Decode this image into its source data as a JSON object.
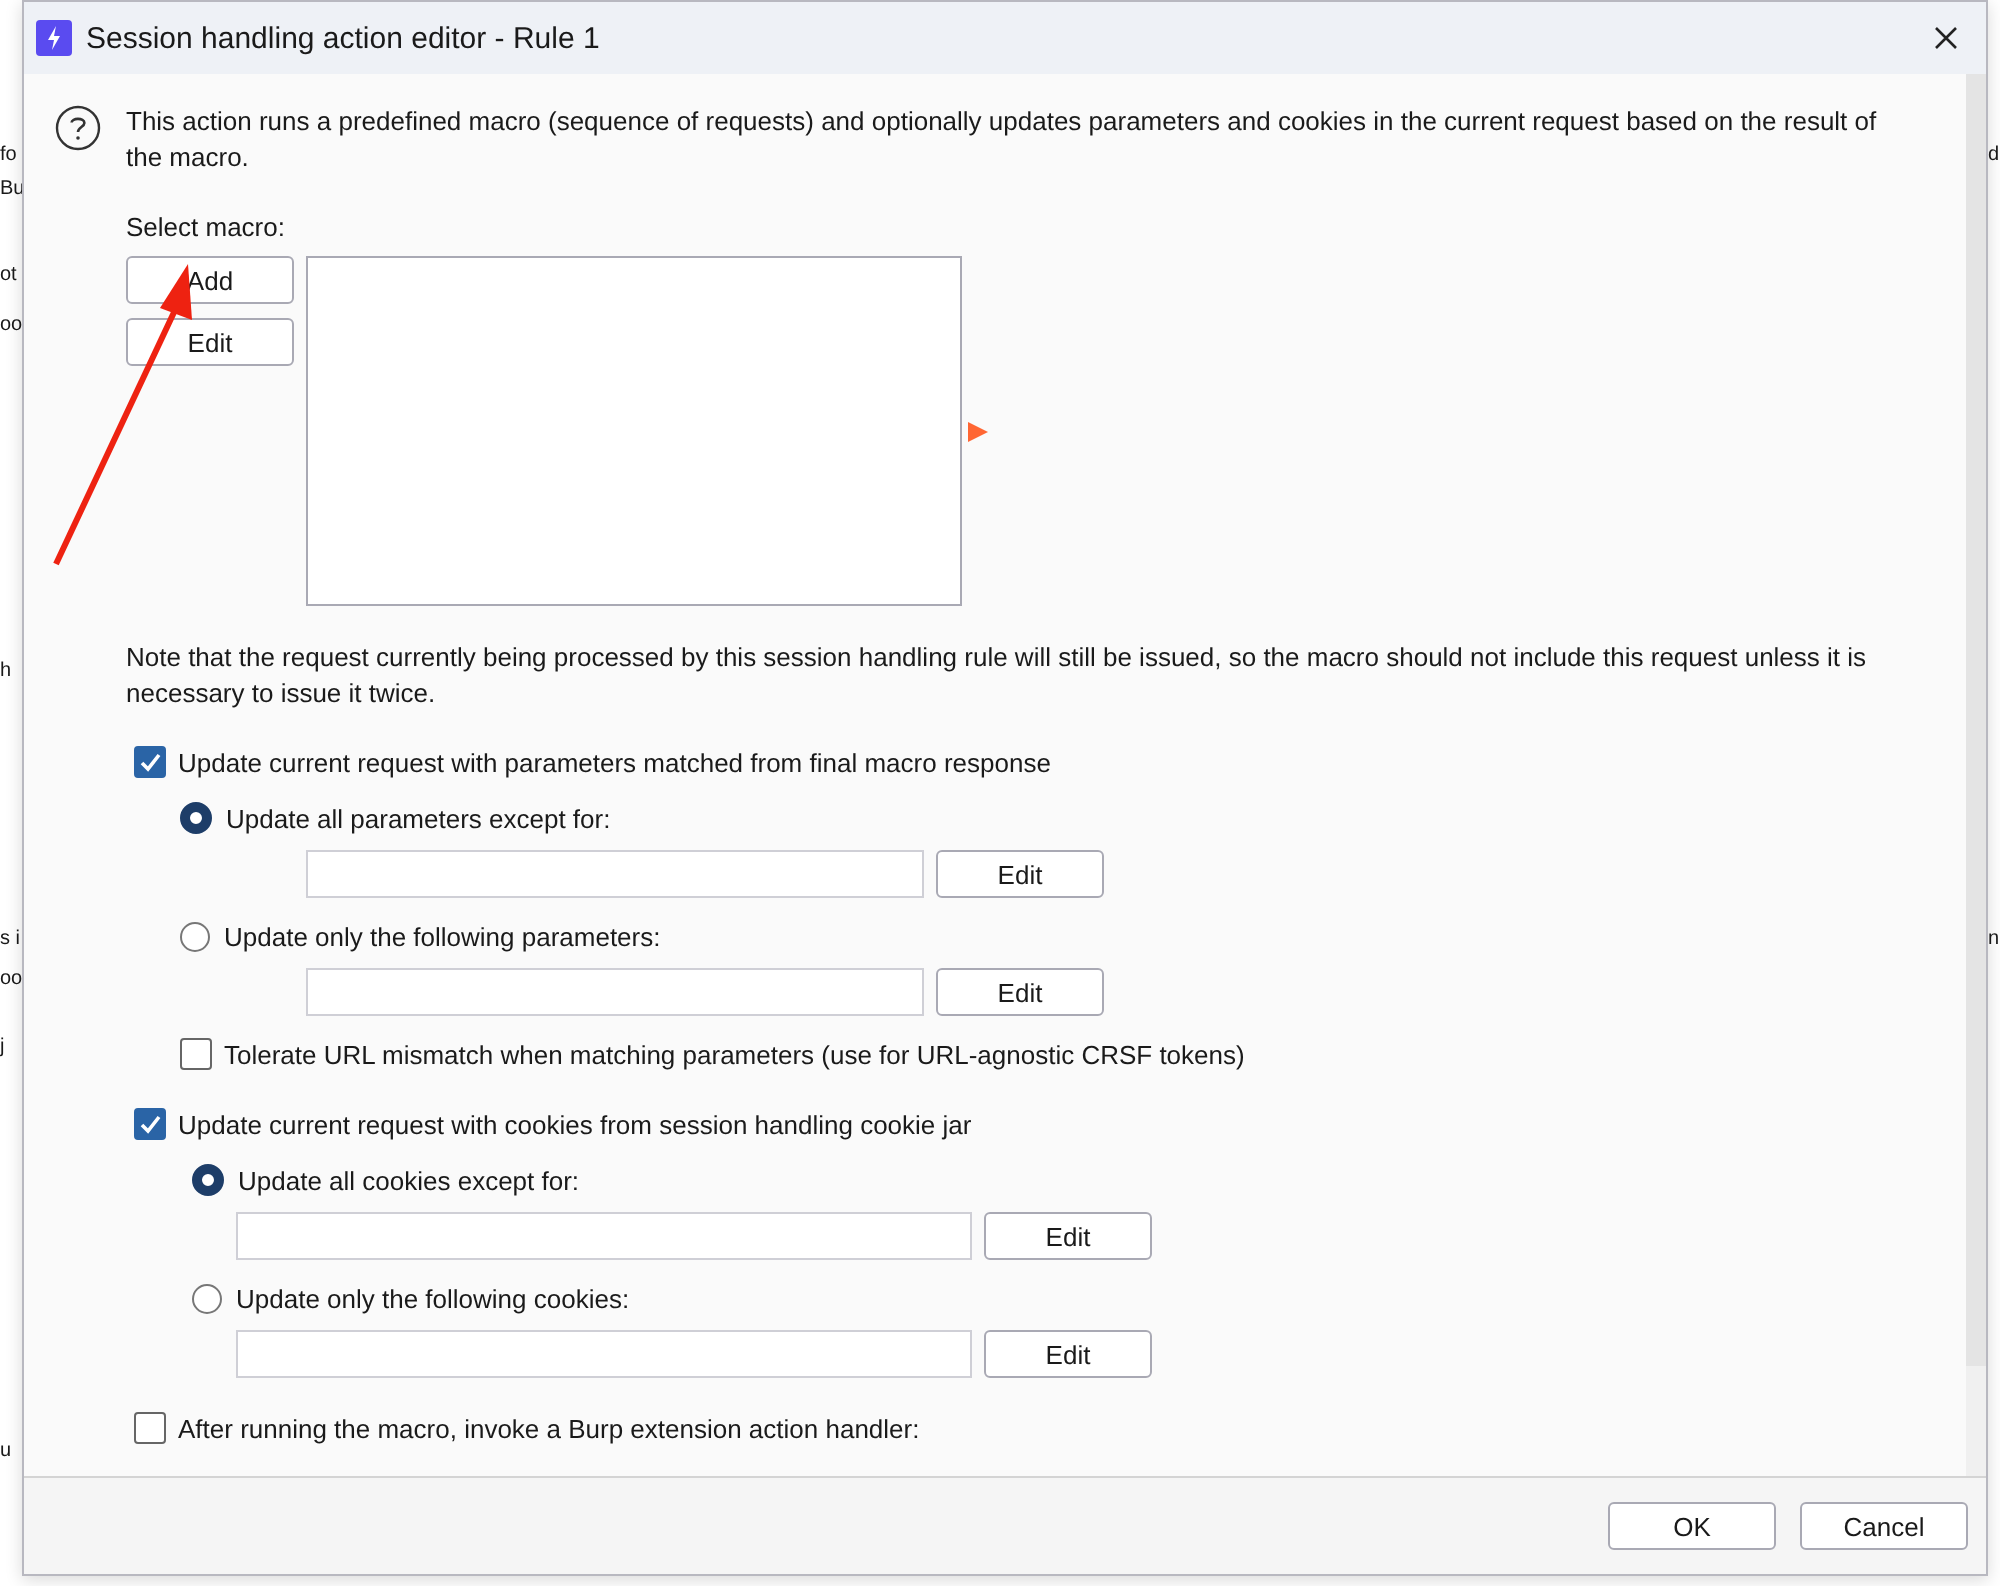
{
  "background_app": {
    "left_fragments": [
      {
        "text": "fo"
      },
      {
        "text": "Bu"
      },
      {
        "text": "ot"
      },
      {
        "text": "oo"
      },
      {
        "text": "h"
      },
      {
        "text": "s i"
      },
      {
        "text": "oo"
      },
      {
        "text": "j"
      },
      {
        "text": "u"
      }
    ],
    "right_fragments": [
      {
        "text": "d"
      },
      {
        "text": "n"
      }
    ]
  },
  "dialog": {
    "title": "Session handling action editor - Rule 1",
    "description": "This action runs a predefined macro (sequence of requests) and optionally updates parameters and cookies in the current request based on the result of the macro.",
    "select_macro_label": "Select macro:",
    "macro_buttons": [
      "Add",
      "Edit"
    ],
    "note": "Note that the request currently being processed by this session handling rule will still be issued, so the macro should not include this request unless it is necessary to issue it twice.",
    "options": [
      {
        "kind": "checkbox",
        "label": "Update current request with parameters matched from final macro response",
        "checked": true,
        "children": [
          {
            "kind": "radio",
            "label": "Update all parameters except for:",
            "selected": true,
            "edit_button": "Edit"
          },
          {
            "kind": "radio",
            "label": "Update only the following parameters:",
            "selected": false,
            "edit_button": "Edit"
          },
          {
            "kind": "checkbox",
            "label": "Tolerate URL mismatch when matching parameters (use for URL-agnostic CRSF tokens)",
            "checked": false
          }
        ]
      },
      {
        "kind": "checkbox",
        "label": "Update current request with cookies from session handling cookie jar",
        "checked": true,
        "children": [
          {
            "kind": "radio",
            "label": "Update all cookies except for:",
            "selected": true,
            "edit_button": "Edit"
          },
          {
            "kind": "radio",
            "label": "Update only the following cookies:",
            "selected": false,
            "edit_button": "Edit"
          }
        ]
      },
      {
        "kind": "checkbox",
        "label": "After running the macro, invoke a Burp extension action handler:",
        "checked": false
      }
    ],
    "buttons": [
      "OK",
      "Cancel"
    ]
  }
}
